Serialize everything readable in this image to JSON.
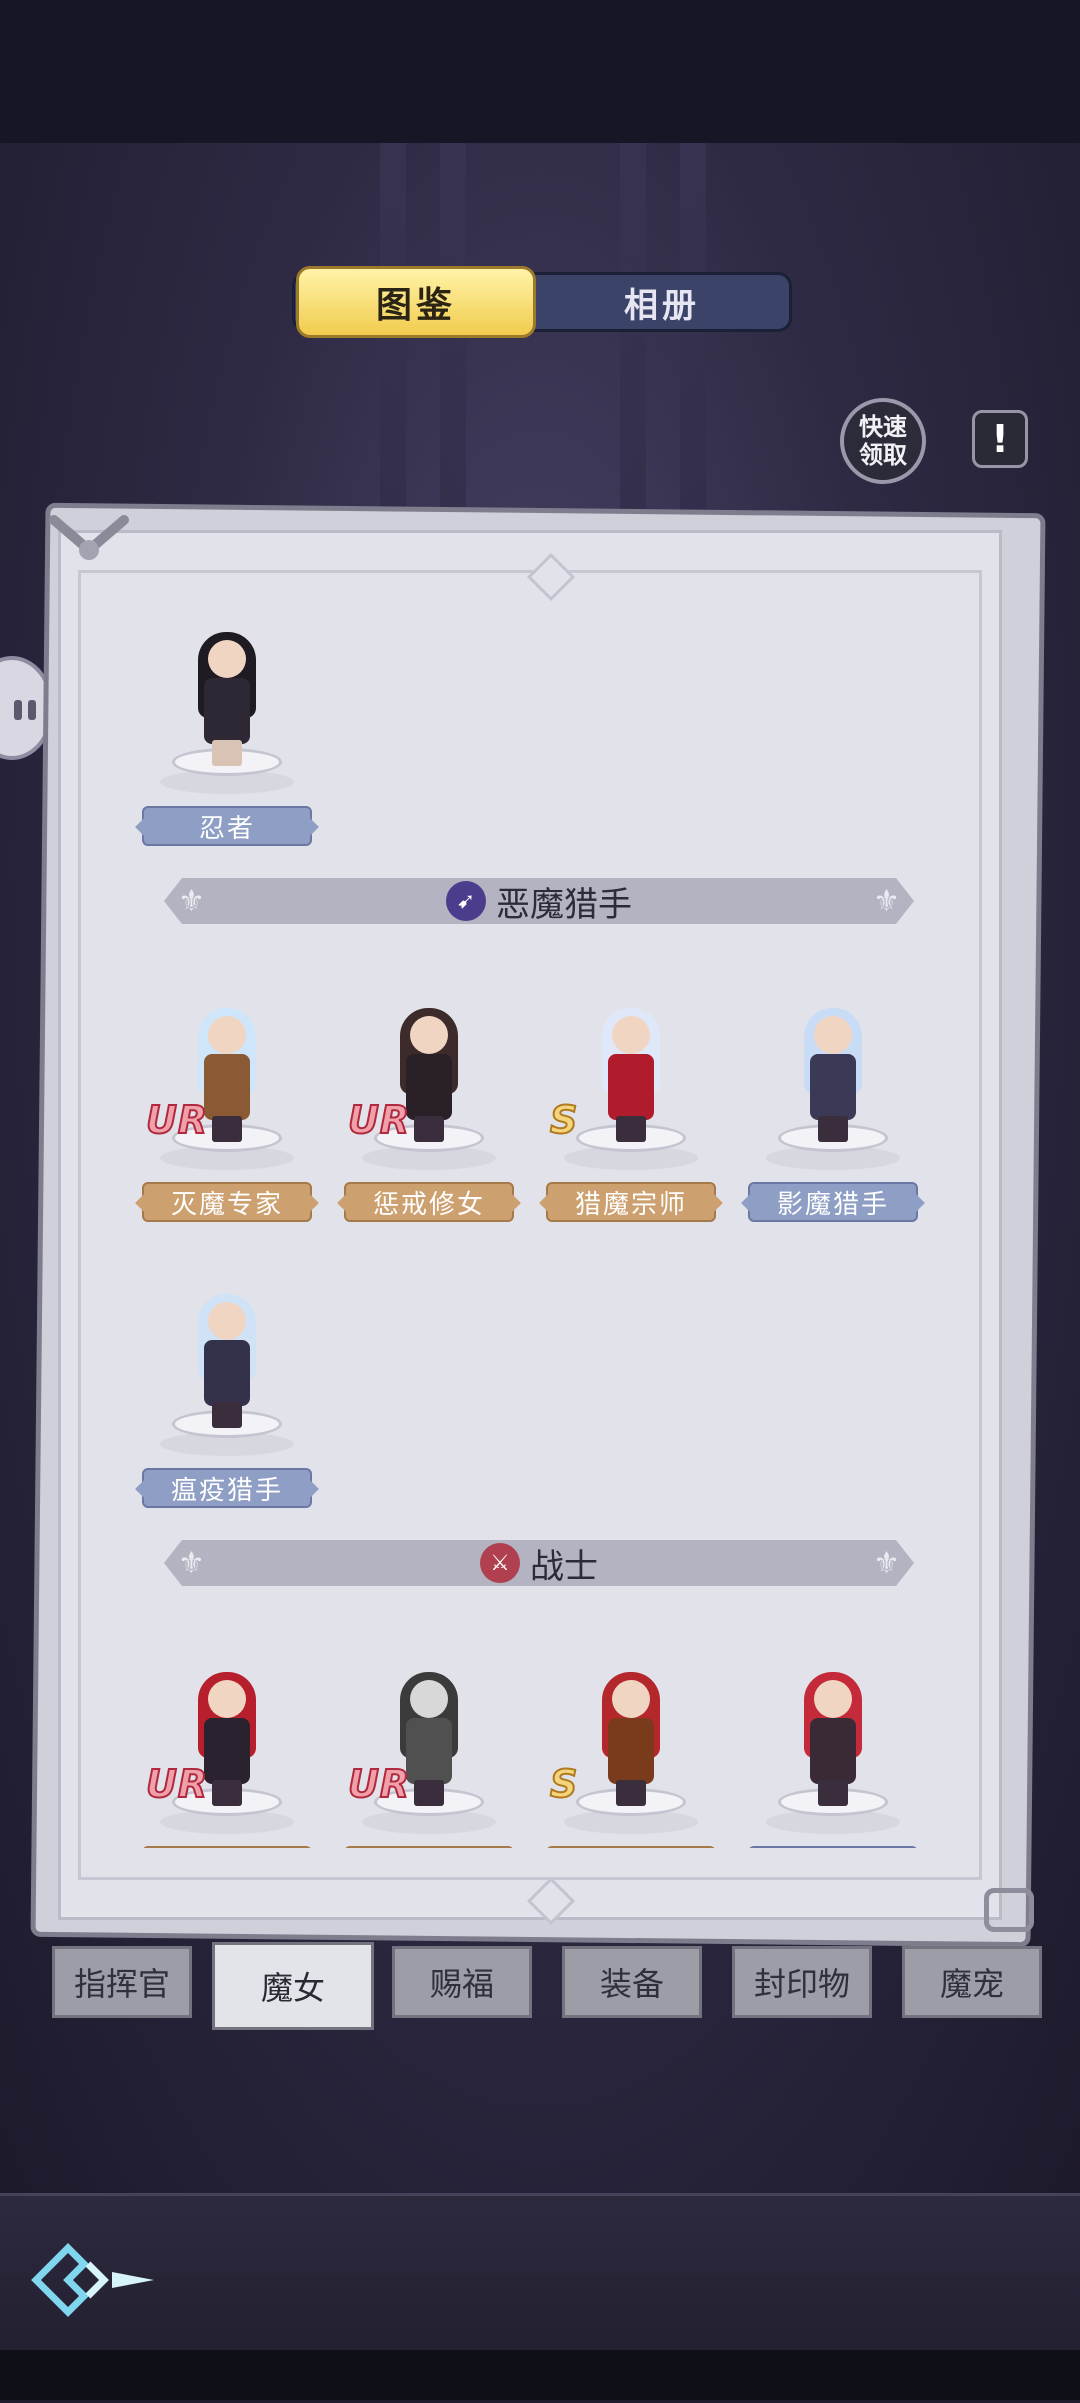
{
  "top_toggle": {
    "codex": "图鉴",
    "album": "相册",
    "active": "codex"
  },
  "quick_claim": [
    "快速",
    "领取"
  ],
  "info_button": "!",
  "single_witch": {
    "label": "忍者",
    "rank": "",
    "label_color": "blue"
  },
  "sections": [
    {
      "title": "恶魔猎手",
      "icon": "demon-hunter-class-icon",
      "icon_color": "#4b3d8c",
      "witches": [
        {
          "label": "灭魔专家",
          "rank": "UR",
          "label_color": "gold"
        },
        {
          "label": "惩戒修女",
          "rank": "UR",
          "label_color": "gold"
        },
        {
          "label": "猎魔宗师",
          "rank": "S",
          "label_color": "gold"
        },
        {
          "label": "影魔猎手",
          "rank": "",
          "label_color": "blue"
        },
        {
          "label": "瘟疫猎手",
          "rank": "",
          "label_color": "blue"
        }
      ]
    },
    {
      "title": "战士",
      "icon": "warrior-class-icon",
      "icon_color": "#b04050",
      "witches": [
        {
          "label": "",
          "rank": "UR",
          "label_color": "gold"
        },
        {
          "label": "",
          "rank": "UR",
          "label_color": "gold"
        },
        {
          "label": "",
          "rank": "S",
          "label_color": "gold"
        },
        {
          "label": "",
          "rank": "",
          "label_color": "blue"
        }
      ]
    }
  ],
  "bottom_tabs": [
    "指挥官",
    "魔女",
    "赐福",
    "装备",
    "封印物",
    "魔宠"
  ],
  "active_bottom_tab": "魔女",
  "colors": {
    "toggle_active": "#f1cc4e",
    "toggle_inactive": "#3b4468",
    "rank_ur": "#b2283c",
    "rank_s": "#b07a20",
    "label_gold": "#cda070",
    "label_blue": "#8e9ec4"
  }
}
